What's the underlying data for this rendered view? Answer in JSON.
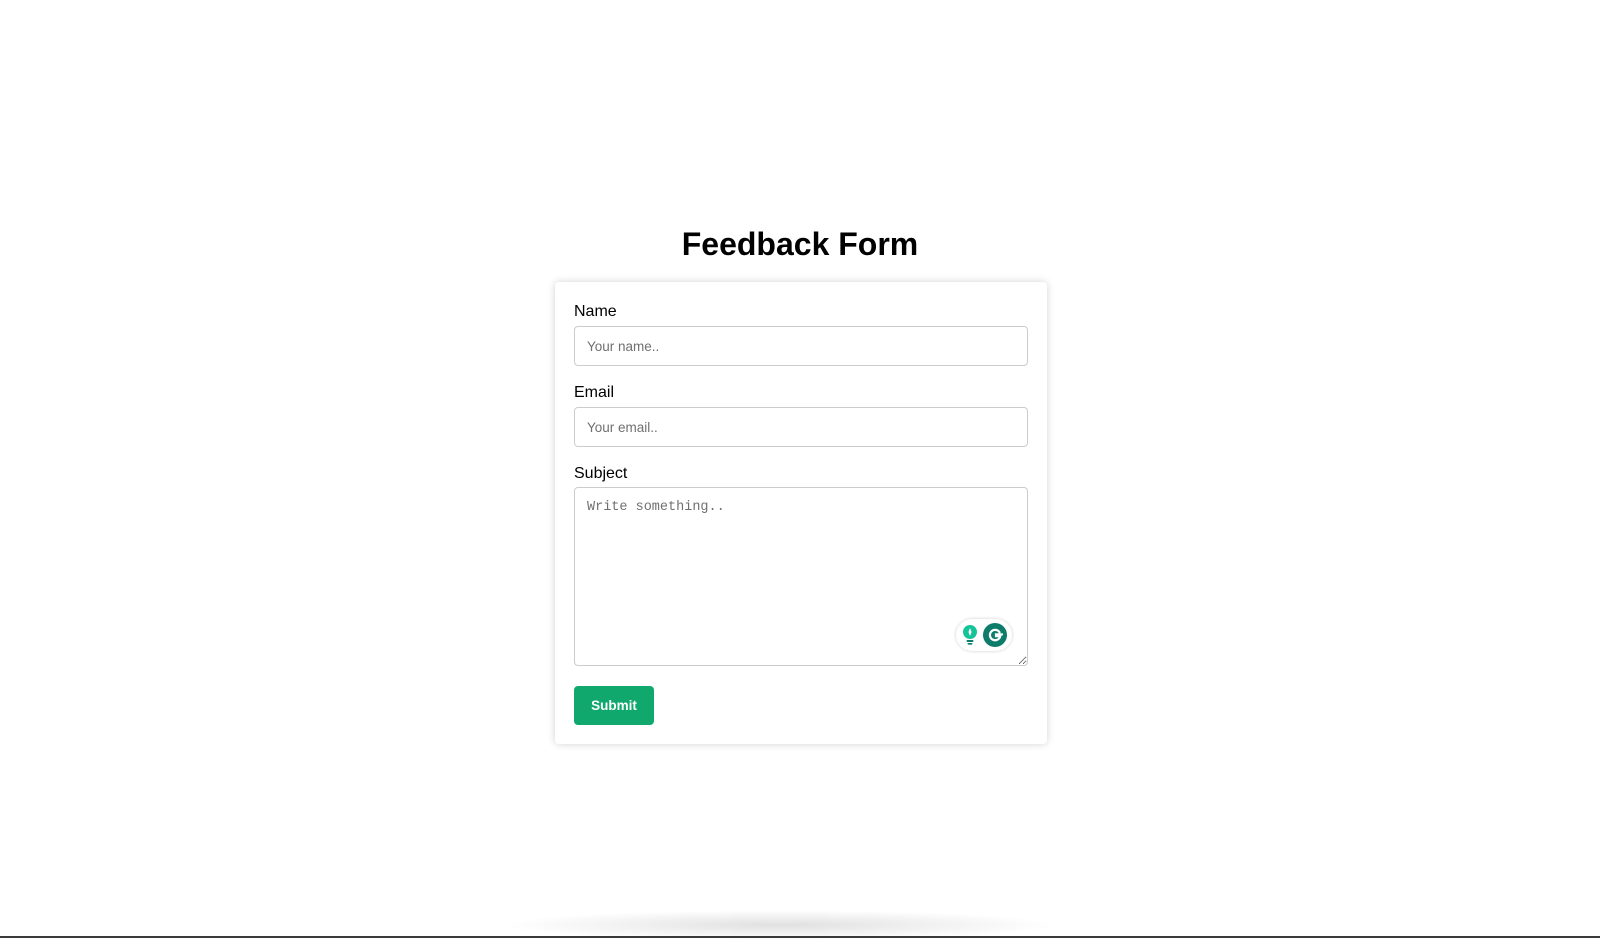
{
  "page": {
    "title": "Feedback Form"
  },
  "form": {
    "name": {
      "label": "Name",
      "value": "",
      "placeholder": "Your name.."
    },
    "email": {
      "label": "Email",
      "value": "",
      "placeholder": "Your email.."
    },
    "subject": {
      "label": "Subject",
      "value": "",
      "placeholder": "Write something.."
    },
    "submit_label": "Submit"
  },
  "extension": {
    "icons": [
      "lightbulb-icon",
      "grammarly-g-icon"
    ]
  },
  "colors": {
    "submit_bg": "#10a86d",
    "grammarly_green": "#15c39a",
    "grammarly_dark": "#0e7c6b",
    "input_border": "#cccccc"
  }
}
